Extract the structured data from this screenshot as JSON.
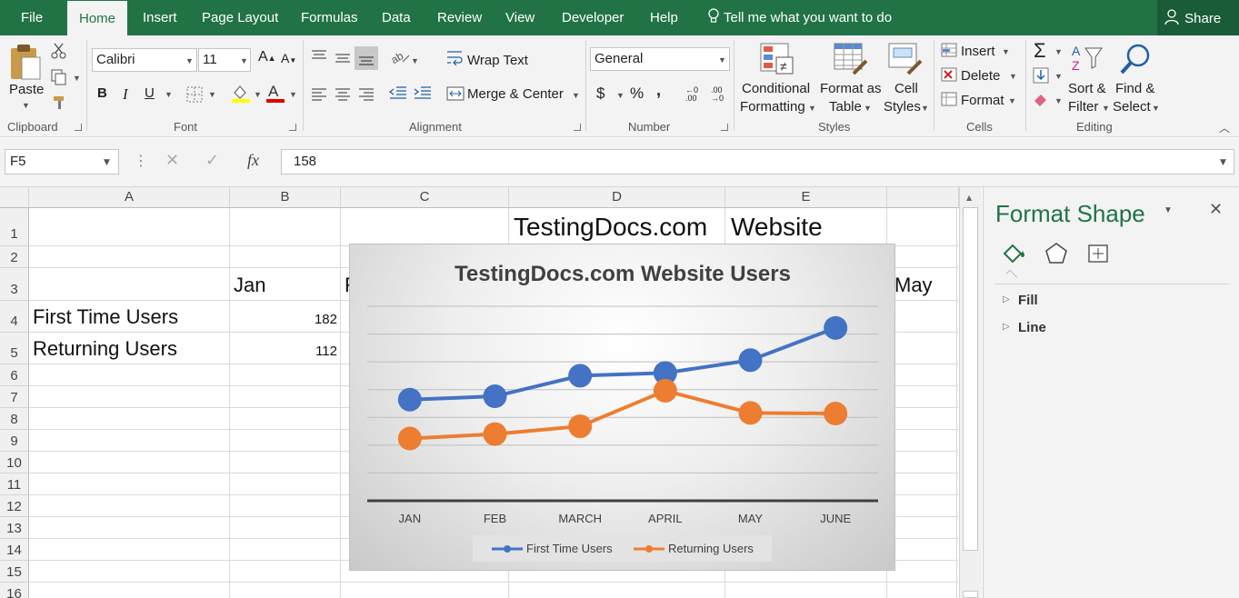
{
  "menu": {
    "tabs": [
      "File",
      "Home",
      "Insert",
      "Page Layout",
      "Formulas",
      "Data",
      "Review",
      "View",
      "Developer",
      "Help"
    ],
    "tell_me": "Tell me what you want to do",
    "share": "Share"
  },
  "ribbon": {
    "clipboard": {
      "paste": "Paste",
      "label": "Clipboard"
    },
    "font": {
      "name": "Calibri",
      "size": "11",
      "bold": "B",
      "italic": "I",
      "underline": "U",
      "label": "Font"
    },
    "alignment": {
      "wrap_text": "Wrap Text",
      "merge_center": "Merge & Center",
      "label": "Alignment"
    },
    "number": {
      "format": "General",
      "currency": "$",
      "percent": "%",
      "comma": ",",
      "inc_dec": "←0 .00",
      "dec_dec": ".00 →0",
      "label": "Number"
    },
    "styles": {
      "conditional_1": "Conditional",
      "conditional_2": "Formatting",
      "format_table_1": "Format as",
      "format_table_2": "Table",
      "cell_styles_1": "Cell",
      "cell_styles_2": "Styles",
      "label": "Styles"
    },
    "cells": {
      "insert": "Insert",
      "delete": "Delete",
      "format": "Format",
      "label": "Cells"
    },
    "editing": {
      "sort_1": "Sort &",
      "sort_2": "Filter",
      "find_1": "Find &",
      "find_2": "Select",
      "label": "Editing"
    }
  },
  "formula_bar": {
    "name_box": "F5",
    "fx": "fx",
    "value": "158"
  },
  "sheet": {
    "columns": [
      "A",
      "B",
      "C",
      "D",
      "E"
    ],
    "rows": [
      "1",
      "2",
      "3",
      "4",
      "5",
      "6",
      "7",
      "8",
      "9",
      "10",
      "11",
      "12",
      "13",
      "14",
      "15",
      "16"
    ],
    "d1": "TestingDocs.com",
    "e1": "Website",
    "b3": "Jan",
    "c3_partial": "F",
    "f3": "May",
    "a4": "First Time Users",
    "b4": "182",
    "a5": "Returning Users",
    "b5": "112"
  },
  "chart_data": {
    "type": "line",
    "title": "TestingDocs.com Website Users",
    "categories": [
      "JAN",
      "FEB",
      "MARCH",
      "APRIL",
      "MAY",
      "JUNE"
    ],
    "series": [
      {
        "name": "First Time Users",
        "color": "#4472c4",
        "values": [
          182,
          188,
          225,
          230,
          253,
          311
        ]
      },
      {
        "name": "Returning Users",
        "color": "#ed7d31",
        "values": [
          112,
          120,
          134,
          198,
          158,
          157
        ]
      }
    ],
    "legend": "bottom",
    "grid": true
  },
  "pane": {
    "title": "Format Shape",
    "fill": "Fill",
    "line": "Line"
  }
}
